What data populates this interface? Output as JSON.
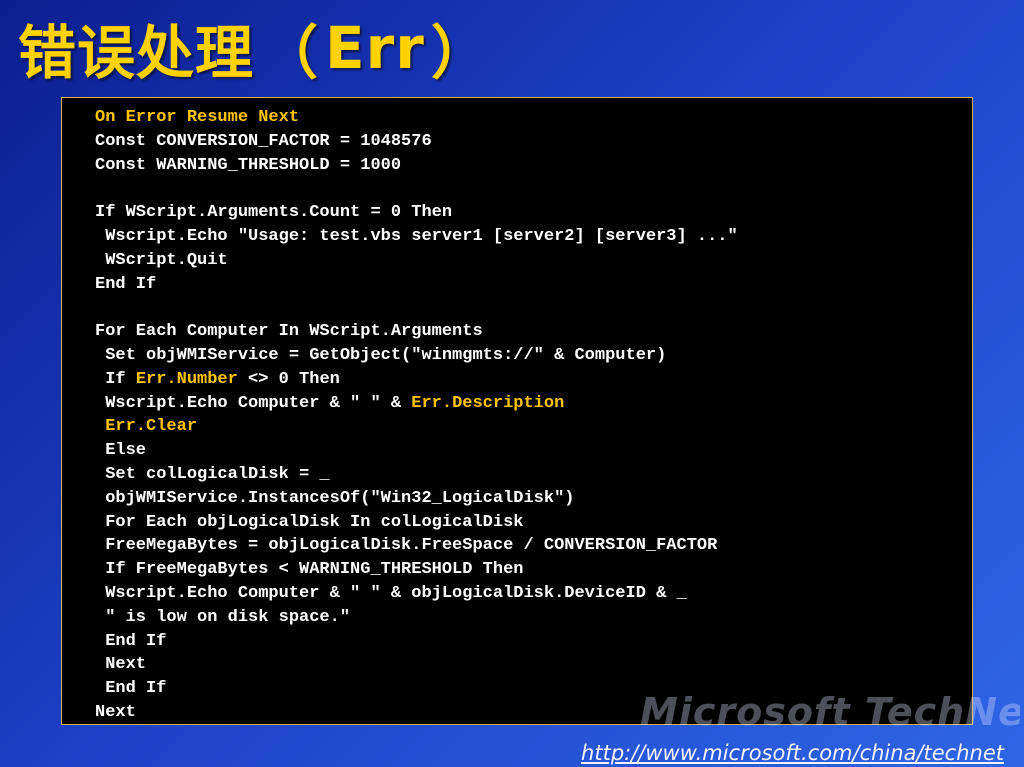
{
  "slide": {
    "title_chinese": "错误处理",
    "title_paren_open": "（",
    "title_keyword": "Err",
    "title_paren_close": "）"
  },
  "colors": {
    "background": "#1c3fc6",
    "title": "#ffd200",
    "code_background": "#000000",
    "code_text": "#ffffff",
    "code_highlight": "#ffc400",
    "code_border": "#d7b24a"
  },
  "code_lines": [
    [
      {
        "text": "On Error Resume Next",
        "color": "yellow"
      }
    ],
    [
      {
        "text": "Const CONVERSION_FACTOR = 1048576",
        "color": "white"
      }
    ],
    [
      {
        "text": "Const WARNING_THRESHOLD = 1000",
        "color": "white"
      }
    ],
    [
      {
        "text": "",
        "color": "white"
      }
    ],
    [
      {
        "text": "If WScript.Arguments.Count = 0 Then",
        "color": "white"
      }
    ],
    [
      {
        "text": " Wscript.Echo \"Usage: test.vbs server1 [server2] [server3] ...\"",
        "color": "white"
      }
    ],
    [
      {
        "text": " WScript.Quit",
        "color": "white"
      }
    ],
    [
      {
        "text": "End If",
        "color": "white"
      }
    ],
    [
      {
        "text": "",
        "color": "white"
      }
    ],
    [
      {
        "text": "For Each Computer In WScript.Arguments",
        "color": "white"
      }
    ],
    [
      {
        "text": " Set objWMIService = GetObject(\"winmgmts://\" & Computer)",
        "color": "white"
      }
    ],
    [
      {
        "text": " If ",
        "color": "white"
      },
      {
        "text": "Err.Number",
        "color": "yellow"
      },
      {
        "text": " <> 0 Then",
        "color": "white"
      }
    ],
    [
      {
        "text": " Wscript.Echo Computer & \" \" & ",
        "color": "white"
      },
      {
        "text": "Err.Description",
        "color": "yellow"
      }
    ],
    [
      {
        "text": " Err.Clear",
        "color": "yellow"
      }
    ],
    [
      {
        "text": " Else",
        "color": "white"
      }
    ],
    [
      {
        "text": " Set colLogicalDisk = _",
        "color": "white"
      }
    ],
    [
      {
        "text": " objWMIService.InstancesOf(\"Win32_LogicalDisk\")",
        "color": "white"
      }
    ],
    [
      {
        "text": " For Each objLogicalDisk In colLogicalDisk",
        "color": "white"
      }
    ],
    [
      {
        "text": " FreeMegaBytes = objLogicalDisk.FreeSpace / CONVERSION_FACTOR",
        "color": "white"
      }
    ],
    [
      {
        "text": " If FreeMegaBytes < WARNING_THRESHOLD Then",
        "color": "white"
      }
    ],
    [
      {
        "text": " Wscript.Echo Computer & \" \" & objLogicalDisk.DeviceID & _",
        "color": "white"
      }
    ],
    [
      {
        "text": " \" is low on disk space.\"",
        "color": "white"
      }
    ],
    [
      {
        "text": " End If",
        "color": "white"
      }
    ],
    [
      {
        "text": " Next",
        "color": "white"
      }
    ],
    [
      {
        "text": " End If",
        "color": "white"
      }
    ],
    [
      {
        "text": "Next",
        "color": "white"
      }
    ]
  ],
  "watermark": {
    "text": "Microsoft TechNet"
  },
  "footer": {
    "url": "http://www.microsoft.com/china/technet"
  }
}
